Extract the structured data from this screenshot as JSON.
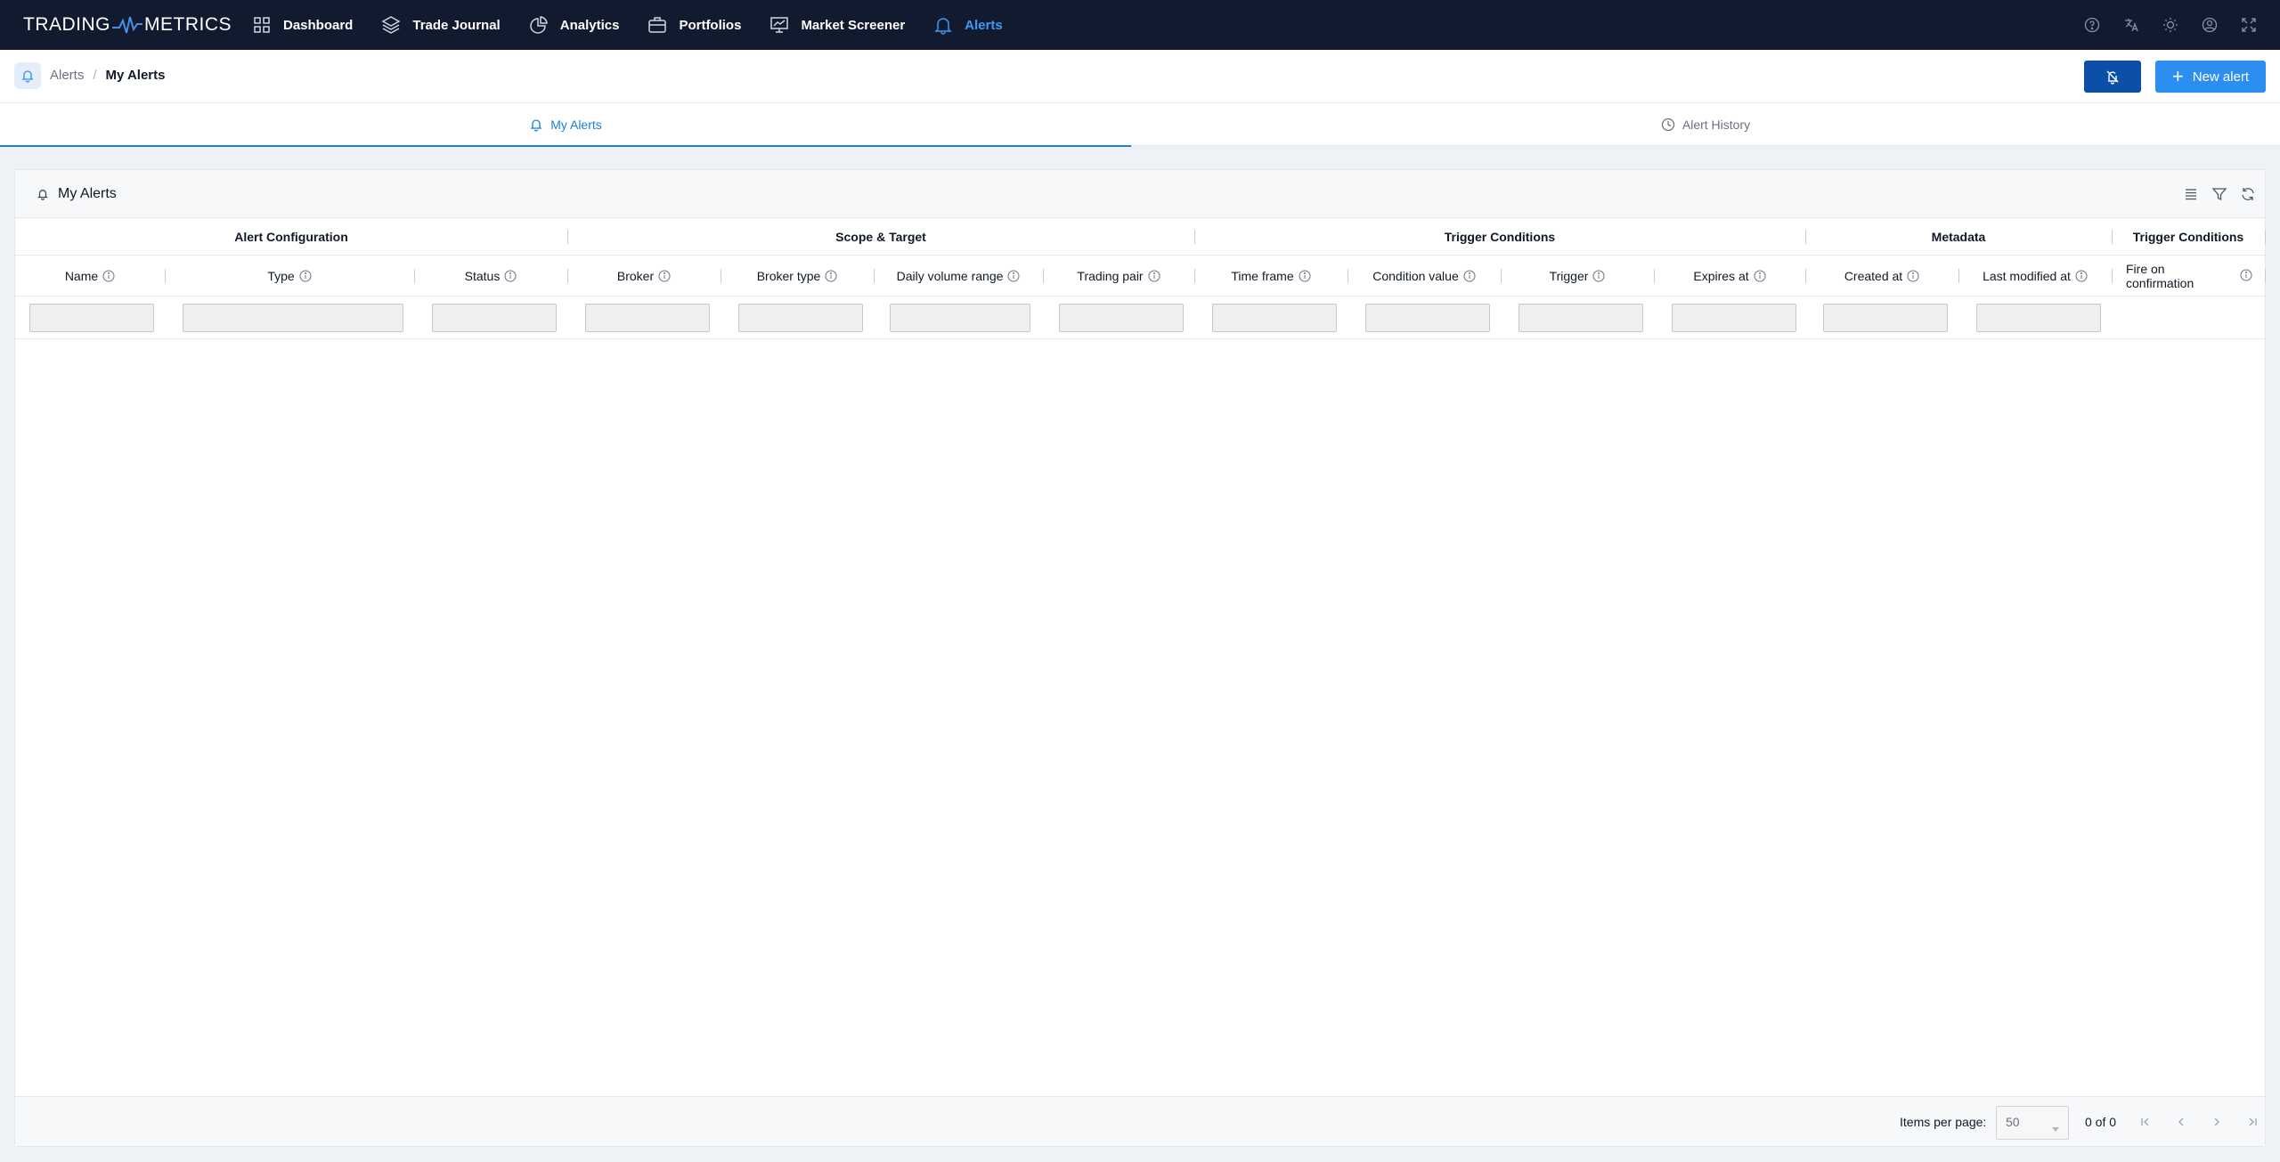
{
  "app": {
    "logo_left": "TRADING",
    "logo_right": "METRICS",
    "nav": [
      {
        "label": "Dashboard",
        "icon": "grid-icon"
      },
      {
        "label": "Trade Journal",
        "icon": "layers-icon"
      },
      {
        "label": "Analytics",
        "icon": "pie-chart-icon"
      },
      {
        "label": "Portfolios",
        "icon": "briefcase-icon"
      },
      {
        "label": "Market Screener",
        "icon": "presentation-chart-icon"
      },
      {
        "label": "Alerts",
        "icon": "bell-icon",
        "active": true
      }
    ],
    "right_icons": [
      "help-icon",
      "translate-icon",
      "sun-icon",
      "user-icon",
      "fullscreen-icon"
    ]
  },
  "breadcrumb": {
    "parent": "Alerts",
    "separator": "/",
    "current": "My Alerts"
  },
  "actions": {
    "mute_icon": "bell-off-icon",
    "new_alert_label": "New alert"
  },
  "tabs": [
    {
      "label": "My Alerts",
      "icon": "bell-icon",
      "active": true
    },
    {
      "label": "Alert History",
      "icon": "clock-icon",
      "active": false
    }
  ],
  "card": {
    "title": "My Alerts",
    "tools": [
      "list-icon",
      "filter-icon",
      "refresh-icon"
    ]
  },
  "grid": {
    "groups": [
      "Alert Configuration",
      "Scope & Target",
      "Trigger Conditions",
      "Metadata",
      "Trigger Conditions"
    ],
    "columns": [
      "Name",
      "Type",
      "Status",
      "Broker",
      "Broker type",
      "Daily volume range",
      "Trading pair",
      "Time frame",
      "Condition value",
      "Trigger",
      "Expires at",
      "Created at",
      "Last modified at",
      "Fire on confirmation"
    ]
  },
  "pagination": {
    "items_per_page_label": "Items per page:",
    "items_per_page_value": "50",
    "range": "0 of 0"
  },
  "colors": {
    "nav_bg": "#111a2e",
    "accent": "#2a8ff0",
    "active_tab": "#1b7fe0",
    "mute_button": "#0b4fa8"
  }
}
